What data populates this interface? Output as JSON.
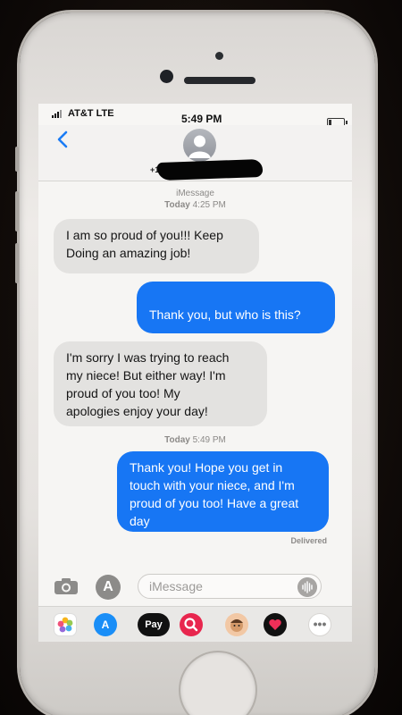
{
  "status_bar": {
    "carrier": "AT&T  LTE",
    "time": "5:49 PM"
  },
  "header": {
    "contact_prefix": "+1"
  },
  "thread": {
    "service_label": "iMessage",
    "first_timestamp_day": "Today",
    "first_timestamp_time": "4:25 PM",
    "second_timestamp_day": "Today",
    "second_timestamp_time": "5:49 PM",
    "messages": [
      {
        "direction": "received",
        "text": "I am so proud of you!!! Keep\nDoing an amazing job!"
      },
      {
        "direction": "sent",
        "text": "Thank you, but who is this?",
        "emoji": "😅"
      },
      {
        "direction": "received",
        "text": "I'm sorry I was trying to reach\nmy niece! But either way! I'm\nproud of you too! My\napologies enjoy your day!"
      },
      {
        "direction": "sent",
        "text": "Thank you! Hope you get in\ntouch with your niece, and I'm\nproud of you too! Have a great\nday"
      }
    ],
    "delivery_status": "Delivered"
  },
  "composer": {
    "placeholder": "iMessage"
  },
  "app_drawer": {
    "apple_pay_label": "Pay",
    "icons": [
      "photos-icon",
      "app-store-icon",
      "apple-pay-icon",
      "image-search-icon",
      "memoji-icon",
      "digital-touch-icon",
      "more-icon"
    ]
  },
  "colors": {
    "sent_bubble": "#1776f4",
    "received_bubble": "#e3e2e0",
    "ios_blue": "#1a7cf5",
    "phone_body": "#e5e2df"
  }
}
